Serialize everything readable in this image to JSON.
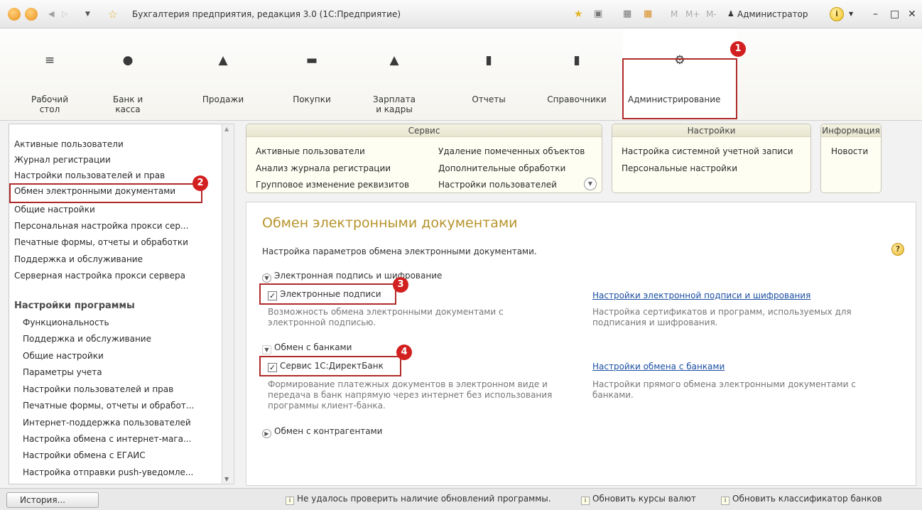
{
  "window": {
    "title": "Бухгалтерия предприятия, редакция 3.0  (1С:Предприятие)",
    "user": "Администратор",
    "m_buttons": [
      "M",
      "M+",
      "M-"
    ]
  },
  "sections": [
    {
      "label": "Рабочий стол",
      "icon": "list-icon",
      "glyph": "≡"
    },
    {
      "label": "Банк и касса",
      "icon": "bank-icon",
      "glyph": "●"
    },
    {
      "label": "Продажи",
      "icon": "sales-icon",
      "glyph": "▲"
    },
    {
      "label": "Покупки",
      "icon": "cart-icon",
      "glyph": "▬"
    },
    {
      "label": "Зарплата и кадры",
      "icon": "person-icon",
      "glyph": "▲"
    },
    {
      "label": "Отчеты",
      "icon": "chart-icon",
      "glyph": "▮"
    },
    {
      "label": "Справочники",
      "icon": "books-icon",
      "glyph": "▮"
    },
    {
      "label": "Администрирование",
      "icon": "gear-icon",
      "glyph": "⚙"
    }
  ],
  "sidebar": {
    "items": [
      "Активные пользователи",
      "Журнал регистрации",
      "Настройки пользователей и прав",
      "Обмен электронными документами",
      "Общие настройки",
      "Персональная настройка прокси сер...",
      "Печатные формы, отчеты и обработки",
      "Поддержка и обслуживание",
      "Серверная настройка прокси сервера"
    ],
    "group_title": "Настройки программы",
    "group_items": [
      "Функциональность",
      "Поддержка и обслуживание",
      "Общие настройки",
      "Параметры учета",
      "Настройки пользователей и прав",
      "Печатные формы, отчеты и обработ...",
      "Интернет-поддержка пользователей",
      "Настройка обмена с интернет-мага...",
      "Настройки обмена с ЕГАИС",
      "Настройка отправки push-уведомле..."
    ]
  },
  "panels": {
    "service": {
      "title": "Сервис",
      "col1": [
        "Активные пользователи",
        "Анализ журнала регистрации",
        "Групповое изменение реквизитов"
      ],
      "col2": [
        "Удаление помеченных объектов",
        "Дополнительные обработки",
        "Настройки пользователей"
      ]
    },
    "settings": {
      "title": "Настройки",
      "items": [
        "Настройка системной учетной записи",
        "Персональные настройки"
      ]
    },
    "info": {
      "title": "Информация",
      "items": [
        "Новости"
      ]
    }
  },
  "content": {
    "title": "Обмен электронными документами",
    "subtitle": "Настройка параметров обмена электронными документами.",
    "help": "?",
    "sig_group": "Электронная подпись и шифрование",
    "sig_checkbox": "Электронные подписи",
    "sig_desc": "Возможность обмена электронными документами с электронной подписью.",
    "sig_link": "Настройки электронной подписи и шифрования",
    "sig_link_desc": "Настройка сертификатов и программ, используемых для подписания и шифрования.",
    "bank_group": "Обмен с банками",
    "bank_checkbox": "Сервис 1С:ДиректБанк",
    "bank_desc": "Формирование платежных документов в электронном виде и передача в банк напрямую через интернет без использования программы клиент-банка.",
    "bank_link": "Настройки обмена с банками",
    "bank_link_desc": "Настройки прямого обмена электронными документами с банками.",
    "contr_group": "Обмен с контрагентами"
  },
  "status": {
    "history": "История...",
    "msg1": "Не удалось проверить наличие обновлений программы.",
    "msg2": "Обновить курсы валют",
    "msg3": "Обновить классификатор банков"
  },
  "badges": [
    "1",
    "2",
    "3",
    "4"
  ],
  "colors": {
    "accent": "#c9302c",
    "title": "#b6932b",
    "link": "#1a4ea2",
    "highlight": "#b02a2a"
  }
}
